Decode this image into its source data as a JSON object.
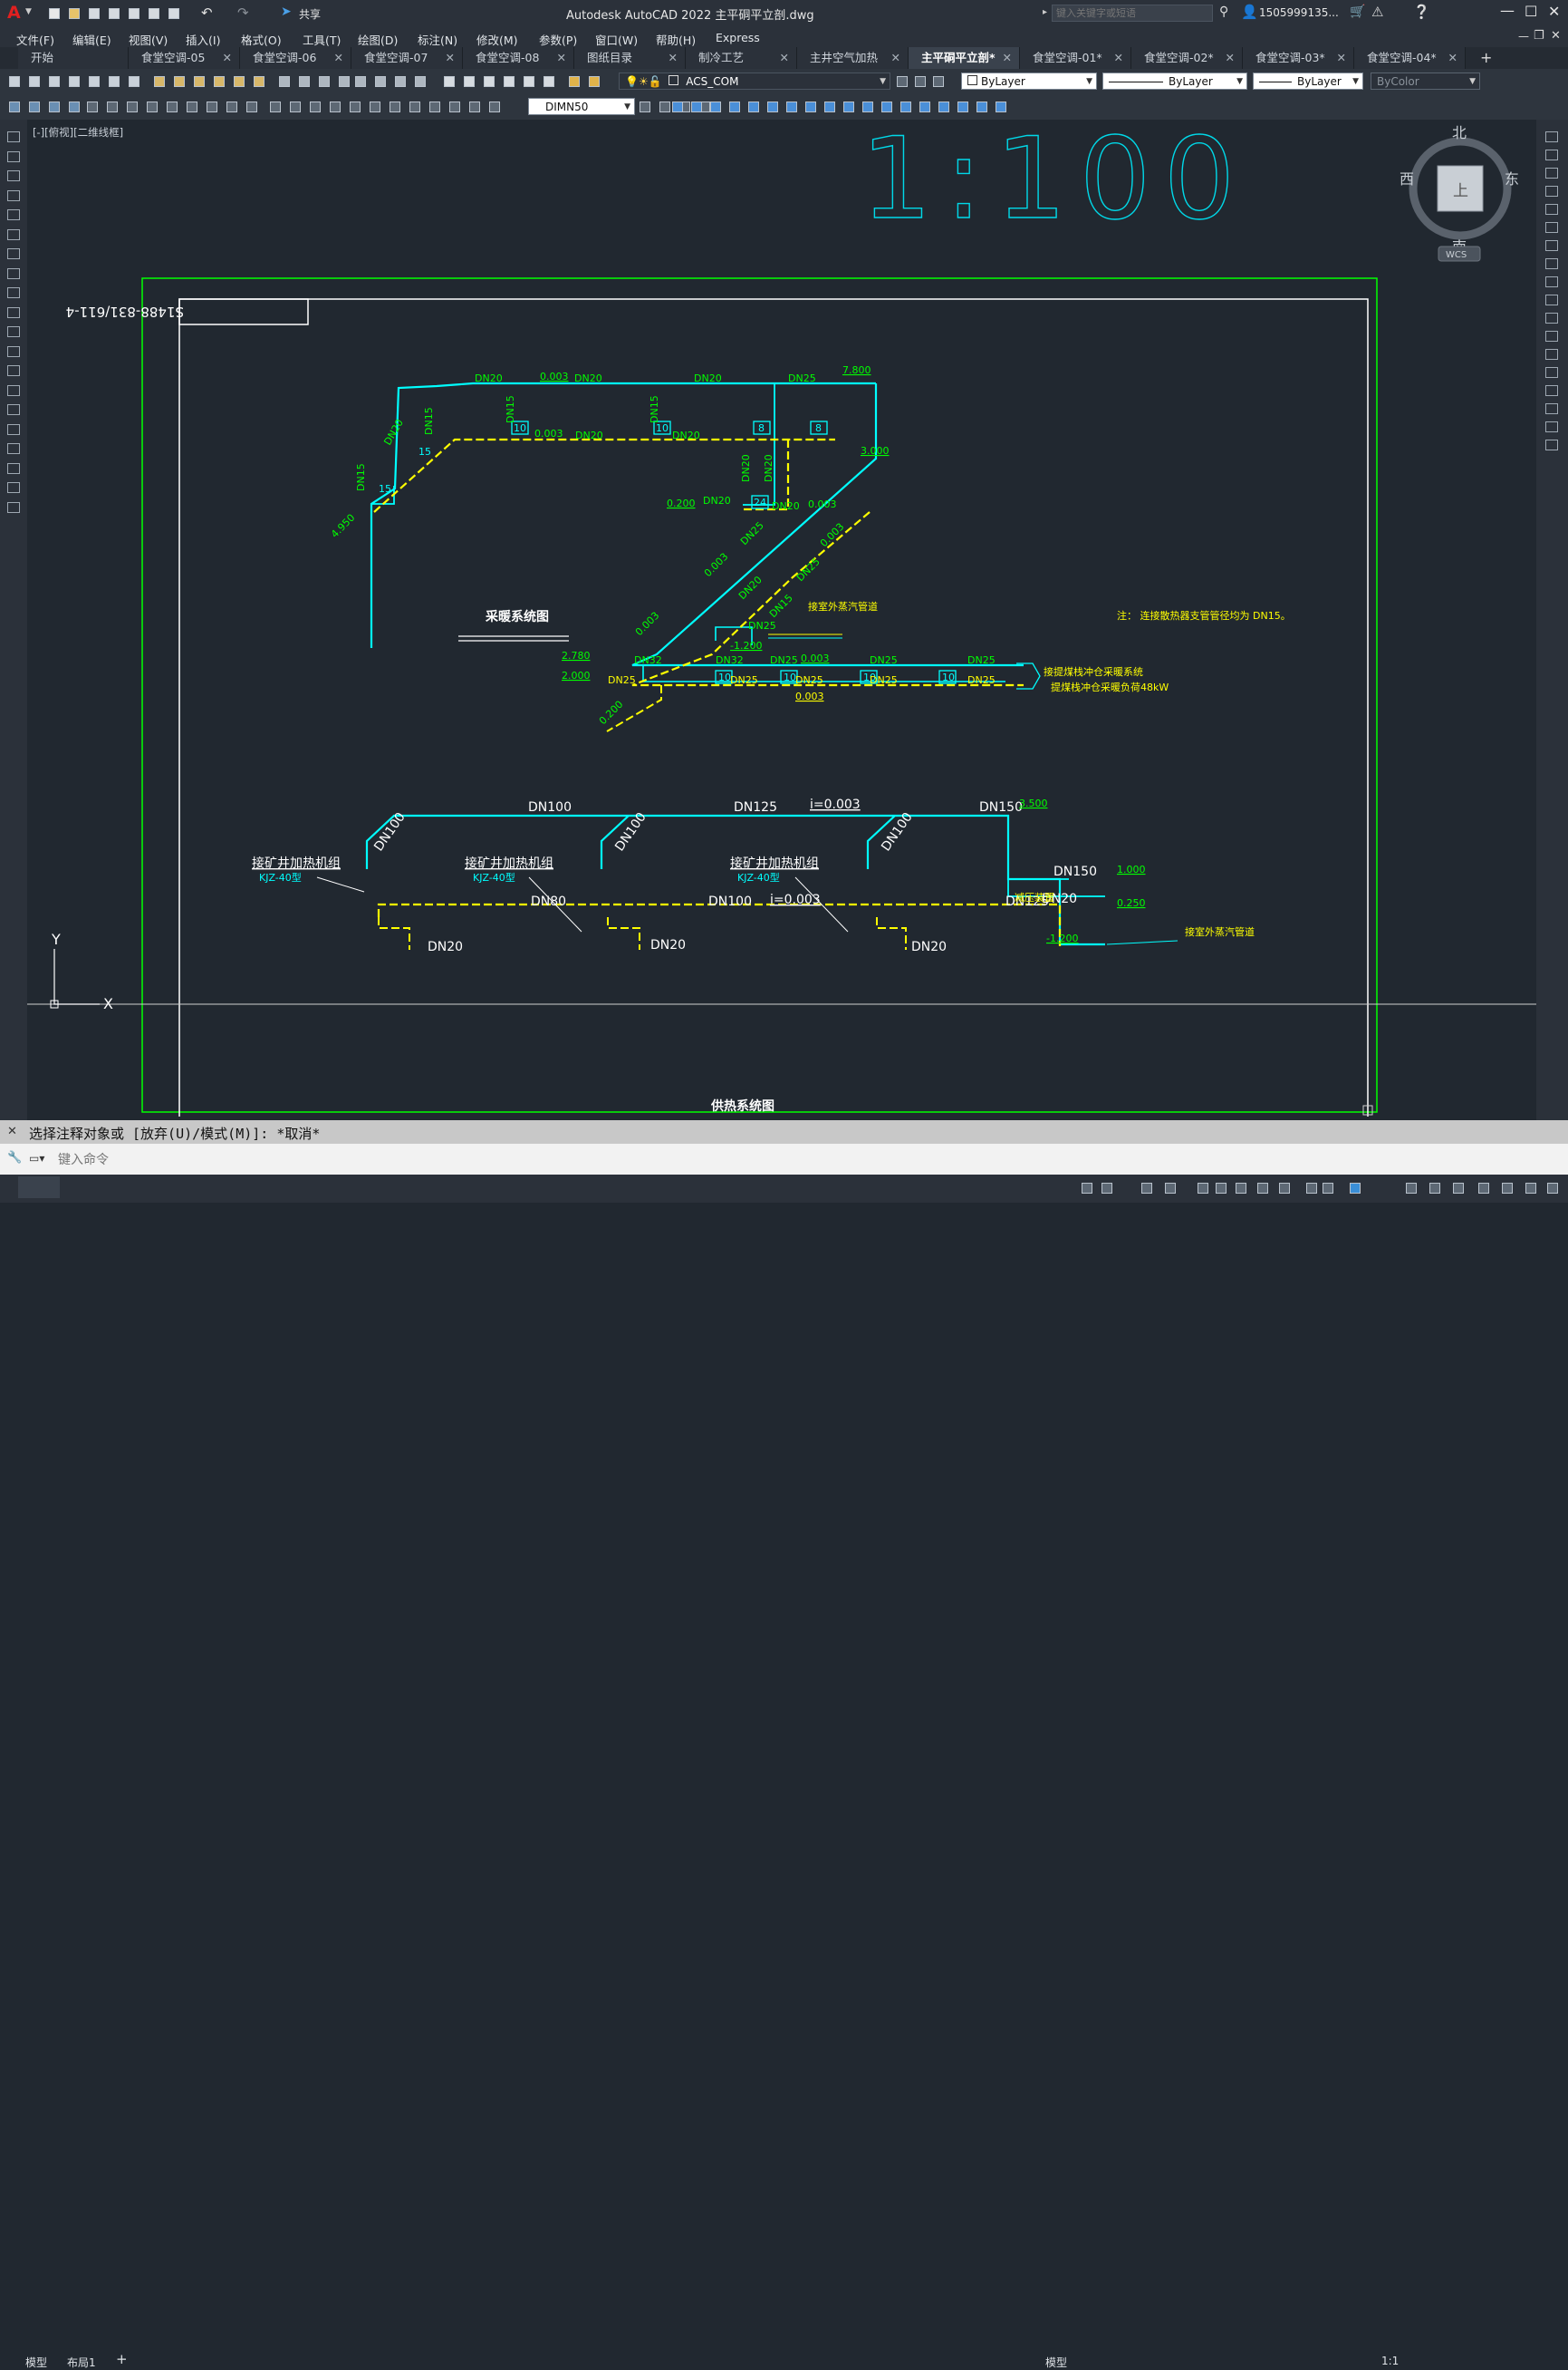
{
  "app": {
    "title": "Autodesk AutoCAD 2022    主平硐平立剖.dwg",
    "share_label": "共享",
    "search_placeholder": "键入关键字或短语",
    "user": "1505999135...",
    "logo_letter": "A"
  },
  "menu": [
    "文件(F)",
    "编辑(E)",
    "视图(V)",
    "插入(I)",
    "格式(O)",
    "工具(T)",
    "绘图(D)",
    "标注(N)",
    "修改(M)",
    "参数(P)",
    "窗口(W)",
    "帮助(H)",
    "Express"
  ],
  "tabs": [
    {
      "label": "开始"
    },
    {
      "label": "食堂空调-05"
    },
    {
      "label": "食堂空调-06"
    },
    {
      "label": "食堂空调-07"
    },
    {
      "label": "食堂空调-08"
    },
    {
      "label": "图纸目录"
    },
    {
      "label": "制冷工艺"
    },
    {
      "label": "主井空气加热"
    },
    {
      "label": "主平硐平立剖*"
    },
    {
      "label": "食堂空调-01*"
    },
    {
      "label": "食堂空调-02*"
    },
    {
      "label": "食堂空调-03*"
    },
    {
      "label": "食堂空调-04*"
    }
  ],
  "toolbar": {
    "layer": "ACS_COM",
    "color": "ByLayer",
    "linetype": "ByLayer",
    "lineweight": "ByLayer",
    "plotstyle": "ByColor",
    "dimstyle": "DIMN50"
  },
  "viewport": {
    "label": "[-][俯视][二维线框]",
    "compass": {
      "n": "北",
      "s": "南",
      "e": "东",
      "w": "西",
      "top": "上"
    },
    "wcs": "WCS",
    "ucs_x": "X",
    "ucs_y": "Y"
  },
  "drawing": {
    "scale": "1:100",
    "code": "S1488-831/611-4",
    "title_heating": "采暖系统图",
    "title_supply": "供热系统图",
    "note": "注：  连接散热器支管管径均为  DN15。",
    "label_outdoor1": "接室外蒸汽管道",
    "label_outdoor2": "接室外蒸汽管道",
    "label_warehouse1": "接提煤栈冲仓采暖系统",
    "label_warehouse2": "提煤栈冲仓采暖负荷48kW",
    "unit_label": "接矿井加热机组",
    "unit_model": "KJZ-40型",
    "elev": {
      "e7800": "7.800",
      "e3000": "3.000",
      "e4950": "4.950",
      "e0200a": "0.200",
      "e2780": "2.780",
      "e2000": "2.000",
      "e0200b": "0.200",
      "e1200a": "-1.200",
      "e3500": "3.500",
      "e1000": "1.000",
      "e0250": "0.250",
      "e1200b": "-1.200"
    },
    "slope": "0.003",
    "slope_i": "i=0.003",
    "dn": {
      "dn15": "DN15",
      "dn20": "DN20",
      "dn25": "DN25",
      "dn32": "DN32",
      "dn80": "DN80",
      "dn100": "DN100",
      "dn125": "DN125",
      "dn150": "DN150"
    },
    "rad": {
      "r10": "10",
      "r8": "8",
      "r15": "15",
      "r24": "24"
    },
    "valve_label": "减压装置"
  },
  "command": {
    "history": "选择注释对象或 [放弃(U)/模式(M)]: *取消*",
    "placeholder": "键入命令"
  },
  "status": {
    "model": "模型",
    "layout1": "布局1",
    "add": "+",
    "model_btn": "模型",
    "scale": "1:1"
  }
}
